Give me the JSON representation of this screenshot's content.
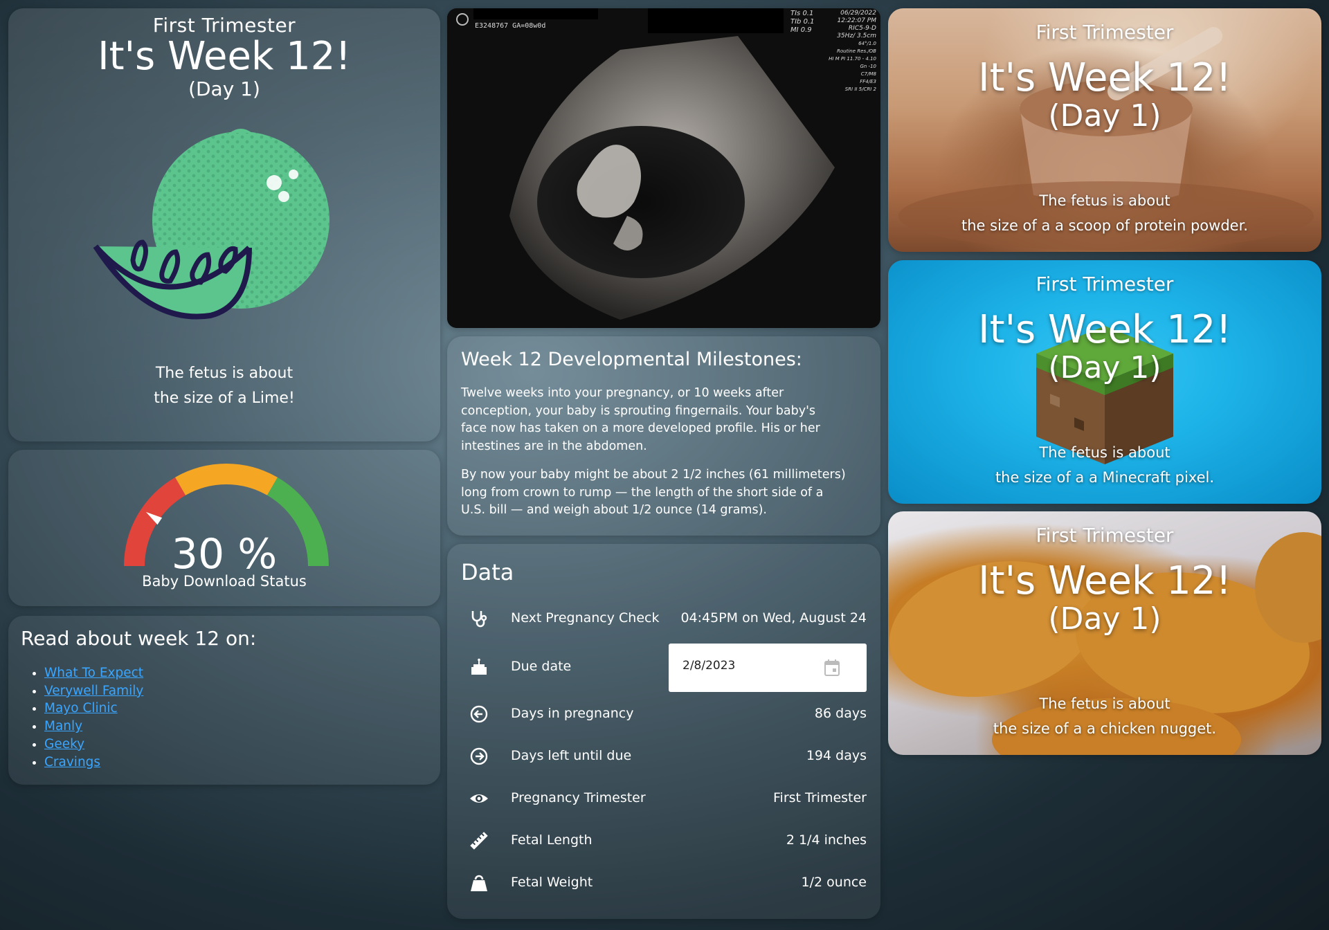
{
  "colors": {
    "accent_link": "#3aa6ff",
    "lime_green": "#5cc48d",
    "lime_outline": "#1f1a4b",
    "gauge_red": "#e0443a",
    "gauge_orange": "#f5a623",
    "gauge_green": "#4caf50"
  },
  "lime_card": {
    "trimester": "First Trimester",
    "week": "It's Week 12!",
    "day": "(Day 1)",
    "fetus_line1": "The fetus is about",
    "fetus_line2": "the size of a Lime!",
    "icon": "lime-icon"
  },
  "gauge": {
    "percent_value": 30,
    "percent_text": "30 %",
    "label": "Baby Download Status"
  },
  "links": {
    "title": "Read about week 12 on:",
    "items": [
      "What To Expect",
      "Verywell Family",
      "Mayo Clinic",
      "Manly",
      "Geeky",
      "Cravings"
    ]
  },
  "ultrasound": {
    "id_text": "E3248767  GA=08w0d",
    "ti_text": "TIs  0.1",
    "tib_text": "TIb  0.1",
    "mi_text": "MI  0.9",
    "date": "06/29/2022",
    "time": "12:22:07 PM",
    "probe1": "RIC5-9-D",
    "probe2": "35Hz/ 3.5cm",
    "probe3": "64°/1.0",
    "probe4": "Routine Res./OB",
    "probe5": "HI M PI 11.70 - 4.10",
    "probe6": "Gn -10",
    "probe7": "C7/M8",
    "probe8": "FF4/E3",
    "probe9": "SRI II 5/CRI 2"
  },
  "milestones": {
    "title": "Week 12 Developmental Milestones:",
    "p1": [
      "Twelve weeks into your pregnancy, or 10 weeks after",
      "conception, your baby is sprouting fingernails. Your baby's",
      "face now has taken on a more developed profile. His or her",
      "intestines are in the abdomen."
    ],
    "p2": [
      "By now your baby might be about 2 1/2 inches (61 millimeters)",
      "long from crown to rump — the length of the short side of a",
      "U.S. bill — and weigh about 1/2 ounce (14 grams)."
    ]
  },
  "data": {
    "title": "Data",
    "next_check": {
      "label": "Next Pregnancy Check",
      "value": "04:45PM on Wed, August 24",
      "icon": "stethoscope-icon"
    },
    "due_date": {
      "label": "Due date",
      "value": "2/8/2023",
      "icon": "cake-icon"
    },
    "days_in": {
      "label": "Days in pregnancy",
      "value": "86 days",
      "icon": "arrow-left-circle-icon"
    },
    "days_left": {
      "label": "Days left until due",
      "value": "194 days",
      "icon": "arrow-right-circle-icon"
    },
    "trimester": {
      "label": "Pregnancy Trimester",
      "value": "First Trimester",
      "icon": "eye-icon"
    },
    "length": {
      "label": "Fetal Length",
      "value": "2 1/4 inches",
      "icon": "ruler-icon"
    },
    "weight": {
      "label": "Fetal Weight",
      "value": "1/2 ounce",
      "icon": "weight-icon"
    }
  },
  "picture_cards": [
    {
      "trimester": "First Trimester",
      "week": "It's Week 12!",
      "day": "(Day 1)",
      "fetus_line1": "The fetus is about",
      "fetus_line2": "the size of a a scoop of protein powder."
    },
    {
      "trimester": "First Trimester",
      "week": "It's Week 12!",
      "day": "(Day 1)",
      "fetus_line1": "The fetus is about",
      "fetus_line2": "the size of a a Minecraft pixel."
    },
    {
      "trimester": "First Trimester",
      "week": "It's Week 12!",
      "day": "(Day 1)",
      "fetus_line1": "The fetus is about",
      "fetus_line2": "the size of a a chicken nugget."
    }
  ]
}
